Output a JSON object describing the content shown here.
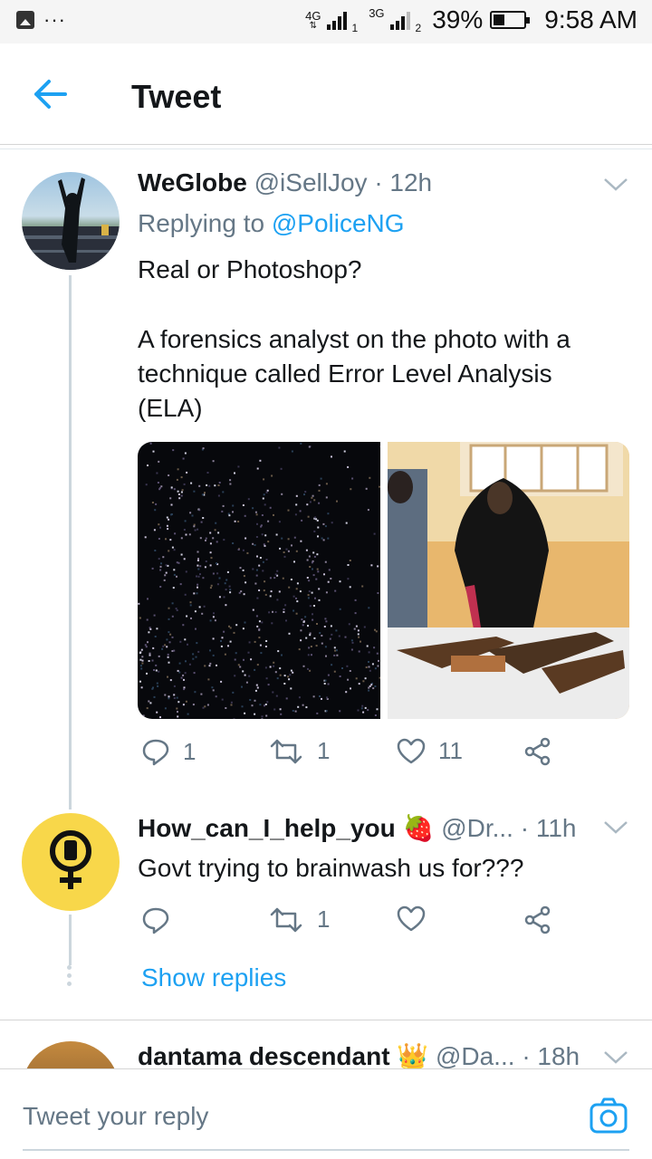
{
  "status_bar": {
    "dots": "···",
    "network_a": "4G",
    "sim_a": "1",
    "network_b": "3G",
    "sim_b": "2",
    "battery_percent": "39%",
    "battery_level": 0.39,
    "time": "9:58 AM"
  },
  "header": {
    "title": "Tweet",
    "back_icon": "arrow-left-icon"
  },
  "colors": {
    "accent": "#1da1f2",
    "secondary_text": "#657786",
    "thread_line": "#ccd6dd",
    "avatar_yellow": "#f8d74a"
  },
  "tweet1": {
    "name": "WeGlobe",
    "handle": "@iSellJoy",
    "time": "· 12h",
    "replying_prefix": "Replying to",
    "replying_to": "@PoliceNG",
    "text_line1": "Real or Photoshop?",
    "text_line2": "A forensics analyst on the photo with a",
    "text_line3": "technique called Error Level Analysis",
    "text_line4": "(ELA)",
    "reply_count": "1",
    "retweet_count": "1",
    "like_count": "11"
  },
  "tweet2": {
    "name": "How_can_I_help_you",
    "emoji": "🍓",
    "handle": "@Dr...",
    "time": "· 11h",
    "text": "Govt trying to brainwash us for???",
    "reply_count": "",
    "retweet_count": "1",
    "like_count": ""
  },
  "show_replies": "Show replies",
  "tweet3": {
    "name": "dantama descendant",
    "emoji": "👑",
    "handle": "@Da...",
    "time": "· 18h"
  },
  "composer": {
    "placeholder": "Tweet your reply",
    "camera_icon": "camera-icon"
  }
}
